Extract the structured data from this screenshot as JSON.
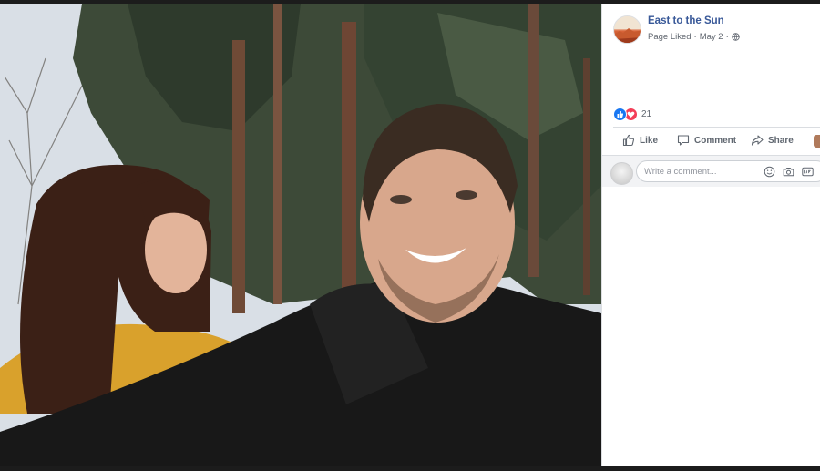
{
  "post": {
    "page_name": "East to the Sun",
    "status": "Page Liked",
    "separator": "·",
    "date": "May 2",
    "date_separator": "·",
    "privacy_icon": "globe-icon"
  },
  "reactions": {
    "icons": [
      "like-reaction-icon",
      "love-reaction-icon"
    ],
    "count": "21"
  },
  "actions": {
    "like_label": "Like",
    "comment_label": "Comment",
    "share_label": "Share"
  },
  "comment": {
    "placeholder": "Write a comment...",
    "icons": [
      "emoji-icon",
      "camera-icon",
      "gif-icon"
    ]
  },
  "colors": {
    "link": "#385898",
    "meta": "#616770",
    "like_blue": "#1877f2",
    "love_red": "#f33e58",
    "action_gray": "#606770"
  }
}
